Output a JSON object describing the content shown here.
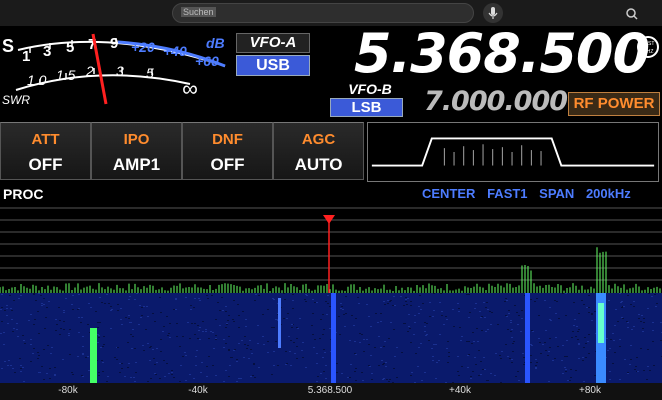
{
  "browser": {
    "search_placeholder": "Suchen"
  },
  "meter": {
    "s_scale": [
      "S",
      "1",
      "3",
      "5",
      "7",
      "9",
      "+20",
      "+40",
      "dB",
      "+60"
    ],
    "swr_scale": [
      "SWR",
      "1.0",
      "1.5",
      "2",
      "3",
      "5",
      "∞"
    ]
  },
  "vfo_a": {
    "label": "VFO-A",
    "mode": "USB",
    "frequency": "5.368.500"
  },
  "vfo_b": {
    "label": "VFO-B",
    "mode": "LSB",
    "frequency": "7.000.000"
  },
  "logo_text": "TEST MHZ",
  "rf_power_label": "RF POWER",
  "functions": [
    {
      "name": "ATT",
      "value": "OFF"
    },
    {
      "name": "IPO",
      "value": "AMP1"
    },
    {
      "name": "DNF",
      "value": "OFF"
    },
    {
      "name": "AGC",
      "value": "AUTO"
    }
  ],
  "proc_label": "PROC",
  "scope_info": {
    "mode": "CENTER",
    "speed": "FAST1",
    "span_label": "SPAN",
    "span_value": "200kHz"
  },
  "axis_ticks": [
    "-80k",
    "-40k",
    "5.368.500",
    "+40k",
    "+80k"
  ],
  "colors": {
    "accent_orange": "#ff8c2e",
    "mode_blue": "#3b5ad8",
    "scope_text_blue": "#4d7cff",
    "marker_red": "#ff2020",
    "signal_green": "#66ff66",
    "waterfall_blue": "#0a1a6c"
  }
}
